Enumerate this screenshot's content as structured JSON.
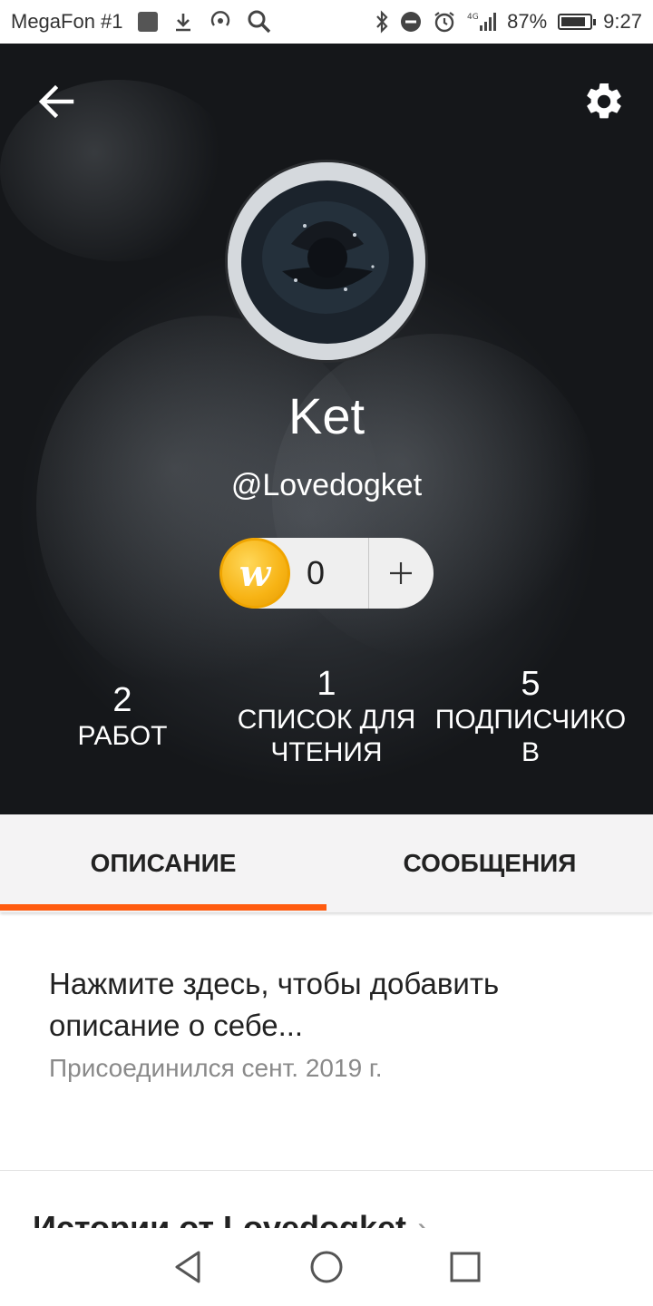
{
  "status_bar": {
    "carrier": "MegaFon #1",
    "battery_percent": "87%",
    "battery_level": 0.87,
    "time": "9:27",
    "network": "4G"
  },
  "header": {
    "back_icon": "arrow-left-icon",
    "settings_icon": "gear-icon"
  },
  "profile": {
    "display_name": "Ket",
    "username": "@Lovedogket",
    "coins": {
      "icon": "wattpad-coin-icon",
      "count": "0",
      "add_label": "+"
    },
    "stats": [
      {
        "value": "2",
        "label": "РАБОТ"
      },
      {
        "value": "1",
        "label_line1": "СПИСОК ДЛЯ",
        "label_line2": "ЧТЕНИЯ"
      },
      {
        "value": "5",
        "label_line1": "ПОДПИСЧИКО",
        "label_line2": "В"
      }
    ]
  },
  "tabs": [
    {
      "label": "ОПИСАНИЕ",
      "active": true
    },
    {
      "label": "СООБЩЕНИЯ",
      "active": false
    }
  ],
  "about": {
    "prompt": "Нажмите здесь, чтобы добавить описание о себе...",
    "joined": "Присоединился сент. 2019 г."
  },
  "stories": {
    "heading": "Истории от Lovedogket",
    "chevron": "›"
  },
  "colors": {
    "accent": "#ff5b0f",
    "coin": "#f7b314",
    "hero_bg": "#1c1e21"
  },
  "nav": {
    "back": "triangle-back-icon",
    "home": "circle-home-icon",
    "recents": "square-recents-icon"
  }
}
